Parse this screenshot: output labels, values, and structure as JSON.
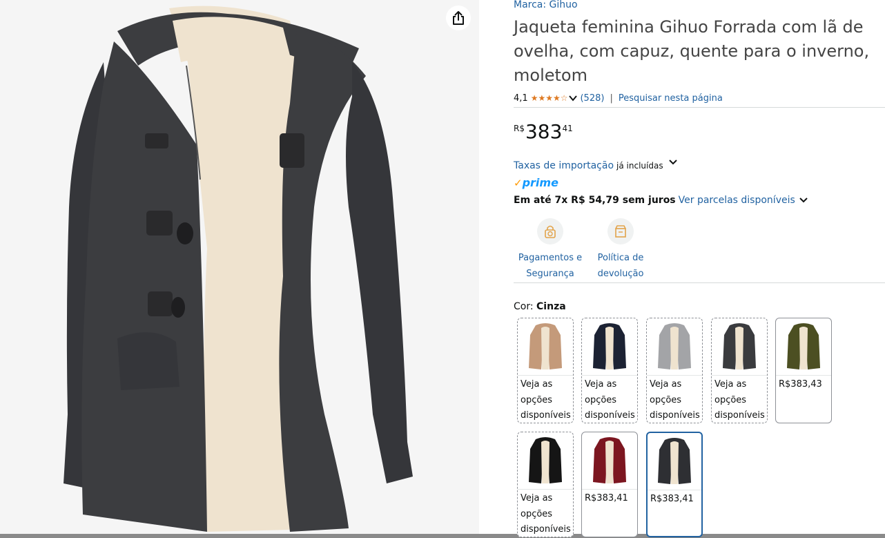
{
  "image_pane": {
    "share_icon": "share-icon"
  },
  "product": {
    "brand": "Marca: Gihuo",
    "title": "Jaqueta feminina Gihuo Forrada com lã de ovelha, com capuz, quente para o inverno, moletom",
    "rating_value": "4,1",
    "stars": "★★★★☆",
    "rating_count": "(528)",
    "separator": "|",
    "search_link": "Pesquisar nesta página"
  },
  "price": {
    "currency": "R$",
    "whole": "383",
    "fraction": "41"
  },
  "tax": {
    "link": "Taxas de importação",
    "note": "já incluídas"
  },
  "prime": {
    "check": "✓",
    "label": "prime"
  },
  "installments": {
    "text": "Em até 7x R$ 54,79 sem juros",
    "link": "Ver parcelas disponíveis"
  },
  "features": [
    {
      "line1": "Pagamentos e",
      "line2": "Segurança",
      "icon": "lock-coin-icon"
    },
    {
      "line1": "Política de",
      "line2": "devolução",
      "icon": "return-box-icon"
    }
  ],
  "color": {
    "label": "Cor:",
    "selected": "Cinza"
  },
  "swatches": [
    {
      "name": "camel",
      "body": "#c49a7a",
      "l1": "Veja as",
      "l2": "opções",
      "l3": "disponíveis"
    },
    {
      "name": "navy",
      "body": "#1c2233",
      "l1": "Veja as",
      "l2": "opções",
      "l3": "disponíveis"
    },
    {
      "name": "light-gray",
      "body": "#a3a4a7",
      "l1": "Veja as",
      "l2": "opções",
      "l3": "disponíveis"
    },
    {
      "name": "charcoal",
      "body": "#3a3b3e",
      "l1": "Veja as",
      "l2": "opções",
      "l3": "disponíveis"
    },
    {
      "name": "army-green",
      "body": "#4c4f22",
      "price": "R$383,43"
    },
    {
      "name": "black",
      "body": "#151515",
      "l1": "Veja as",
      "l2": "opções",
      "l3": "disponíveis"
    },
    {
      "name": "wine-red",
      "body": "#7c1620",
      "price": "R$383,41"
    },
    {
      "name": "gray-selected",
      "body": "#2e2f33",
      "price": "R$383,41"
    }
  ],
  "colors": {
    "link": "#2162a1",
    "star": "#de7921",
    "prime_blue": "#1399ff",
    "prime_orange": "#ff9900",
    "coat": "#3c3d40",
    "fleece": "#efe3cf"
  }
}
